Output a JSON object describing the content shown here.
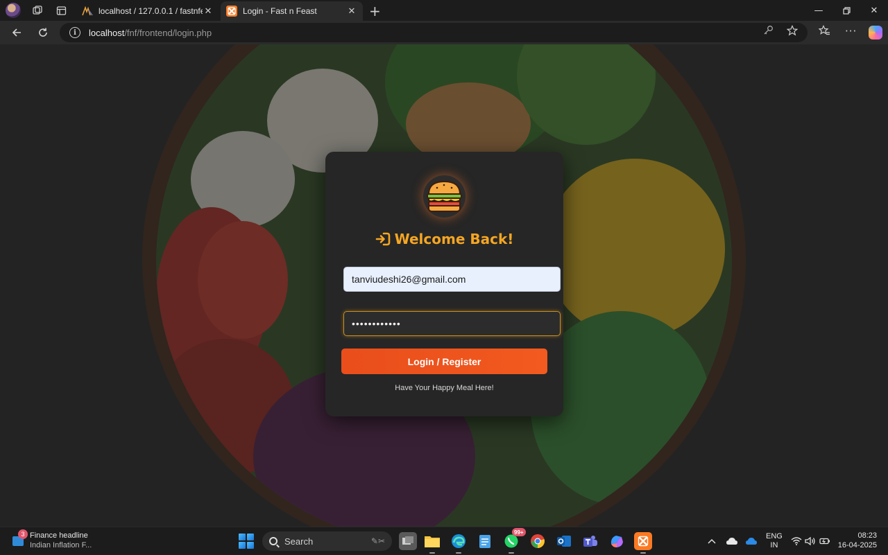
{
  "browser": {
    "tabs": [
      {
        "title": "localhost / 127.0.0.1 / fastnfeast |",
        "favicon": "phpmyadmin-icon"
      },
      {
        "title": "Login - Fast n Feast",
        "favicon": "xampp-icon",
        "active": true
      }
    ],
    "address": {
      "host": "localhost",
      "path": "/fnf/frontend/login.php"
    }
  },
  "login": {
    "heading": "Welcome Back!",
    "heading_icon": "sign-in-icon",
    "logo_icon": "burger-icon",
    "email_value": "tanviudeshi26@gmail.com",
    "password_value": "••••••••••••",
    "button_label": "Login / Register",
    "tagline": "Have Your Happy Meal Here!",
    "accent_color": "#f5a623",
    "button_color": "#eb5020"
  },
  "taskbar": {
    "news": {
      "title": "Finance headline",
      "subtitle": "Indian Inflation F...",
      "badge": "3"
    },
    "search_placeholder": "Search",
    "whatsapp_badge": "99+",
    "lang_top": "ENG",
    "lang_bottom": "IN",
    "time": "08:23",
    "date": "16-04-2025"
  }
}
